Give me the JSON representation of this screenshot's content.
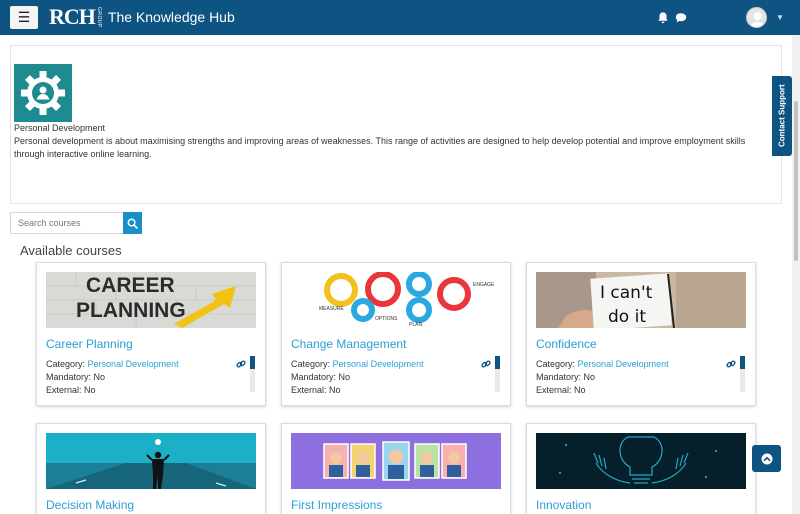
{
  "navbar": {
    "logo_mark": "RCH",
    "logo_sub": "GROUP",
    "site_name": "The Knowledge Hub",
    "menu_icon": "hamburger-icon",
    "notification_icon": "bell-icon",
    "messages_icon": "chat-bubble-icon",
    "user_icon": "avatar-icon",
    "brand_color": "#0e5482"
  },
  "category": {
    "image_icon": "gear-person-icon",
    "title": "Personal Development",
    "description": "Personal development is about maximising strengths and improving areas of weaknesses. This range of activities are designed to help develop potential and improve employment skills through interactive online learning."
  },
  "contact_support": "Contact Support",
  "search": {
    "placeholder": "Search courses",
    "button_icon": "search-icon"
  },
  "section_title": "Available courses",
  "courses": [
    {
      "title": "Career Planning",
      "category_label": "Category:",
      "category": "Personal Development",
      "mandatory": "Mandatory: No",
      "external": "External: No",
      "progress": 0.35
    },
    {
      "title": "Change Management",
      "category_label": "Category:",
      "category": "Personal Development",
      "mandatory": "Mandatory: No",
      "external": "External: No",
      "progress": 0.35
    },
    {
      "title": "Confidence",
      "category_label": "Category:",
      "category": "Personal Development",
      "mandatory": "Mandatory: No",
      "external": "External: No",
      "progress": 0.35
    },
    {
      "title": "Decision Making"
    },
    {
      "title": "First Impressions"
    },
    {
      "title": "Innovation"
    }
  ],
  "images": {
    "career_text_1": "CAREER",
    "career_text_2": "PLANNING",
    "confidence_text_1": "I can't",
    "confidence_text_2": "do it",
    "gear_words": [
      "MEASURE",
      "OPTIONS",
      "PLAN",
      "ENGAGE"
    ]
  },
  "back_to_top_icon": "chevron-up-icon"
}
